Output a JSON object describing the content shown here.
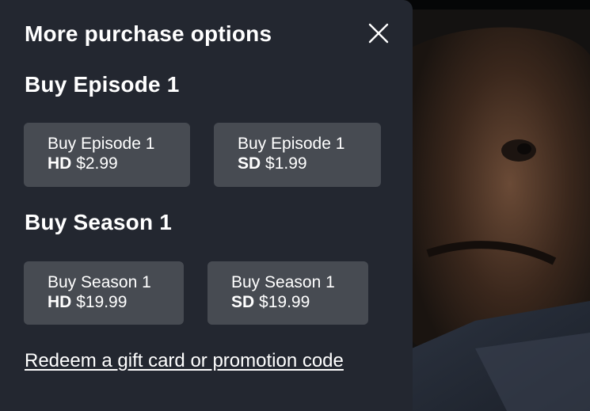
{
  "dialog": {
    "title": "More purchase options",
    "close_icon": "close-icon"
  },
  "episode_section": {
    "heading": "Buy Episode 1",
    "options": [
      {
        "line1": "Buy Episode 1",
        "quality": "HD",
        "price": "$2.99"
      },
      {
        "line1": "Buy Episode 1",
        "quality": "SD",
        "price": "$1.99"
      }
    ]
  },
  "season_section": {
    "heading": "Buy Season 1",
    "options": [
      {
        "line1": "Buy Season 1",
        "quality": "HD",
        "price": "$19.99"
      },
      {
        "line1": "Buy Season 1",
        "quality": "SD",
        "price": "$19.99"
      }
    ]
  },
  "redeem_link": "Redeem a gift card or promotion code",
  "colors": {
    "panel_bg": "#232730",
    "button_bg": "#474b52",
    "text": "#ffffff"
  }
}
